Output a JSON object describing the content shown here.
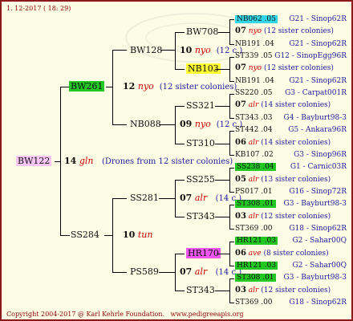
{
  "header": {
    "date": "1. 12-2017 ( 18: 29)"
  },
  "footer": {
    "copyright": "Copyright 2004-2017 @ Karl Kehrle Foundation.",
    "url": "www.pedigreeapis.org"
  },
  "root": {
    "name": "BW122",
    "num": "14",
    "race": "gln",
    "note": "(Drones from 12 sister colonies)"
  },
  "gen1": {
    "top": {
      "name": "BW261"
    },
    "bottom": {
      "name": "SS284"
    }
  },
  "gen2": {
    "bw128": {
      "name": "BW128",
      "num": "12",
      "race": "nyo",
      "note": "(12 sister colonies)"
    },
    "nb088": {
      "name": "NB088",
      "num": "09",
      "race": "nyo",
      "note": "(12 c.)"
    },
    "ss281": {
      "name": "SS281",
      "num": "07",
      "race": "alr",
      "note": "(14 c.)"
    },
    "ps589": {
      "name": "PS589",
      "num": "07",
      "race": "alr",
      "note": "(14 c.)"
    },
    "tun": {
      "num": "10",
      "race": "tun"
    }
  },
  "gen3": {
    "bw708": {
      "name": "BW708",
      "num": "10",
      "race": "nyo",
      "note": "(12 c.)"
    },
    "nb103": {
      "name": "NB103"
    },
    "ss321": {
      "name": "SS321"
    },
    "st310": {
      "name": "ST310"
    },
    "ss255": {
      "name": "SS255"
    },
    "st343a": {
      "name": "ST343"
    },
    "hr170": {
      "name": "HR170"
    },
    "st343b": {
      "name": "ST343"
    }
  },
  "gen4": [
    {
      "id": "NB062 .05",
      "place": "G21 - Sinop62R"
    },
    {
      "num": "07",
      "race": "nyo",
      "note": "(12 sister colonies)"
    },
    {
      "id": "NB191 .04",
      "place": "G21 - Sinop62R"
    },
    {
      "id": "ST339 .05",
      "place": "G12 - SinopEgg96R"
    },
    {
      "num": "07",
      "race": "nyo",
      "note": "(12 sister colonies)"
    },
    {
      "id": "NB191 .04",
      "place": "G21 - Sinop62R"
    },
    {
      "id": "SS220 .05",
      "place": "G3 - Carpat001R"
    },
    {
      "num": "07",
      "race": "alr",
      "note": "(14 sister colonies)"
    },
    {
      "id": "ST343 .03",
      "place": "G4 - Bayburt98-3"
    },
    {
      "id": "ST442 .04",
      "place": "G5 - Ankara96R"
    },
    {
      "num": "06",
      "race": "alr",
      "note": "(14 sister colonies)"
    },
    {
      "id": "KB107 .02",
      "place": "G3 - Sinop96R"
    },
    {
      "id": "SS238 .04",
      "place": "G1 - Carnic03R"
    },
    {
      "num": "05",
      "race": "alr",
      "note": "(13 sister colonies)"
    },
    {
      "id": "PS017 .01",
      "place": "G16 - Sinop72R"
    },
    {
      "id": "ST308 .01",
      "place": "G3 - Bayburt98-3"
    },
    {
      "num": "03",
      "race": "alr",
      "note": "(12 sister colonies)"
    },
    {
      "id": "ST369 .00",
      "place": "G18 - Sinop62R"
    },
    {
      "id": "HR121 .03",
      "place": "G2 - Sahar00Q"
    },
    {
      "num": "06",
      "race": "ave",
      "note": "(8 sister colonies)"
    },
    {
      "id": "HR121 .03",
      "place": "G2 - Sahar00Q"
    },
    {
      "id": "ST308 .01",
      "place": "G3 - Bayburt98-3"
    },
    {
      "num": "03",
      "race": "alr",
      "note": "(12 sister colonies)"
    },
    {
      "id": "ST369 .00",
      "place": "G18 - Sinop62R"
    }
  ],
  "colors": {
    "border": "#8a1a1a",
    "background": "#fdfde6",
    "race": "#cc0000",
    "sisters": "#1c1c9c",
    "cyan": "#33d6e6",
    "green": "#22c722",
    "yellow": "#ffff33",
    "magenta": "#ee55ee",
    "pink": "#f7c6f7"
  }
}
